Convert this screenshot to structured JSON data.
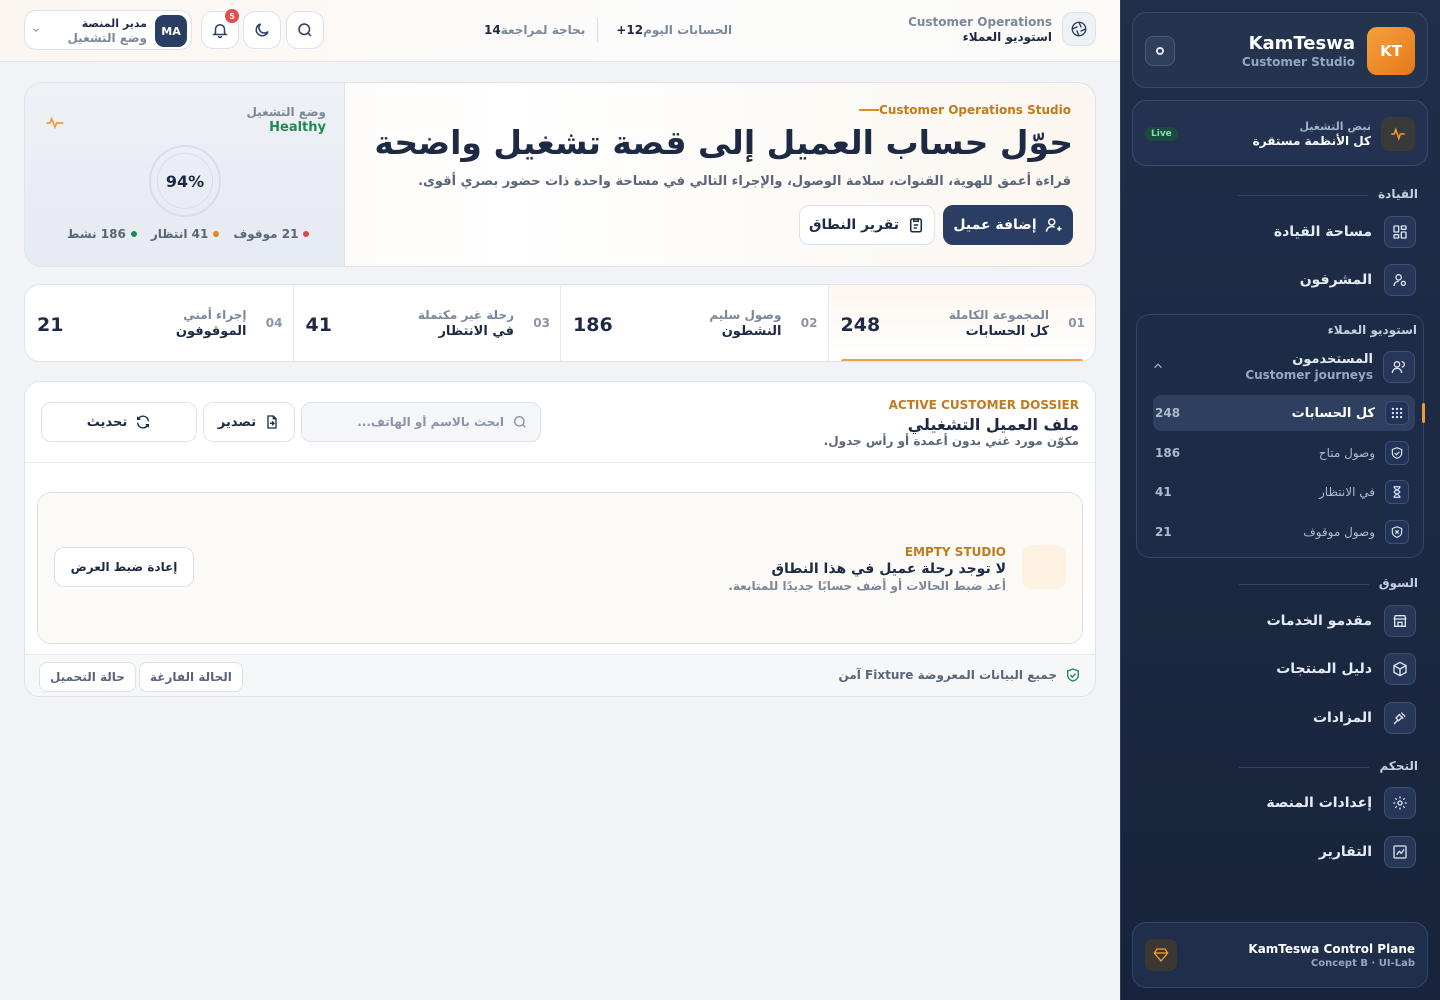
{
  "sidebar": {
    "brand_name": "KamTeswa",
    "brand_sub": "Customer Studio",
    "brand_initials": "KT",
    "pulse_label": "نبض التشغيل",
    "pulse_value": "كل الأنظمة مستقرة",
    "pulse_badge": "Live",
    "sections": {
      "leadership": "القيادة",
      "customers": "استوديو العملاء",
      "market": "السوق",
      "control": "التحكم"
    },
    "nav": {
      "leadership_space": "مساحة القيادة",
      "supervisors": "المشرفون",
      "providers": "مقدمو الخدمات",
      "products": "دليل المنتجات",
      "auctions": "المزادات",
      "platform_settings": "إعدادات المنصة",
      "reports": "التقارير"
    },
    "users_group": {
      "title": "المستخدمون",
      "subtitle": "Customer journeys",
      "items": [
        {
          "label": "كل الحسابات",
          "count": "248",
          "icon": "grid-icon"
        },
        {
          "label": "وصول متاح",
          "count": "186",
          "icon": "shield-check-icon"
        },
        {
          "label": "في الانتظار",
          "count": "41",
          "icon": "hourglass-icon"
        },
        {
          "label": "وصول موقوف",
          "count": "21",
          "icon": "shield-x-icon"
        }
      ]
    },
    "footer_title": "KamTeswa Control Plane",
    "footer_sub": "Concept B · UI-Lab"
  },
  "topbar": {
    "context_label": "Customer Operations",
    "context_title": "استوديو العملاء",
    "today_label": "الحسابات اليوم",
    "today_value": "+12",
    "review_label": "بحاجة لمراجعة",
    "review_value": "14",
    "notif_count": "5",
    "user_initials": "MA",
    "user_name": "مدير المنصة",
    "user_role": "وضع التشغيل"
  },
  "hero": {
    "kicker": "Customer Operations Studio",
    "title": "حوّل حساب العميل إلى قصة تشغيل واضحة",
    "subtitle": "قراءة أعمق للهوية، القنوات، سلامة الوصول، والإجراء التالي في مساحة واحدة ذات حضور بصري أقوى.",
    "primary_button": "إضافة عميل",
    "secondary_button": "تقرير النطاق",
    "status_label": "وضع التشغيل",
    "status_value": "Healthy",
    "health_percent": "94%",
    "legend": [
      {
        "label": "186 نشط",
        "color": "#1f8a4e"
      },
      {
        "label": "41 انتظار",
        "color": "#d98a1f"
      },
      {
        "label": "21 موقوف",
        "color": "#d94646"
      }
    ]
  },
  "stats": [
    {
      "num": "01",
      "kicker": "المجموعة الكاملة",
      "label": "كل الحسابات",
      "value": "248"
    },
    {
      "num": "02",
      "kicker": "وصول سليم",
      "label": "النشطون",
      "value": "186"
    },
    {
      "num": "03",
      "kicker": "رحلة غير مكتملة",
      "label": "في الانتظار",
      "value": "41"
    },
    {
      "num": "04",
      "kicker": "إجراء أمني",
      "label": "الموقوفون",
      "value": "21"
    }
  ],
  "dossier": {
    "kicker": "ACTIVE CUSTOMER DOSSIER",
    "title": "ملف العميل التشغيلي",
    "subtitle": "مكوّن مورد غني بدون أعمدة أو رأس جدول.",
    "search_placeholder": "ابحث بالاسم أو الهاتف...",
    "export_label": "تصدير",
    "refresh_label": "تحديث",
    "empty_kicker": "EMPTY STUDIO",
    "empty_title": "لا توجد رحلة عميل في هذا النطاق",
    "empty_sub": "أعد ضبط الحالات أو أضف حسابًا جديدًا للمتابعة.",
    "reset_label": "إعادة ضبط العرض",
    "footer_note": "جميع البيانات المعروضة Fixture آمن",
    "chip_empty": "الحالة الفارغة",
    "chip_loading": "حالة التحميل"
  }
}
